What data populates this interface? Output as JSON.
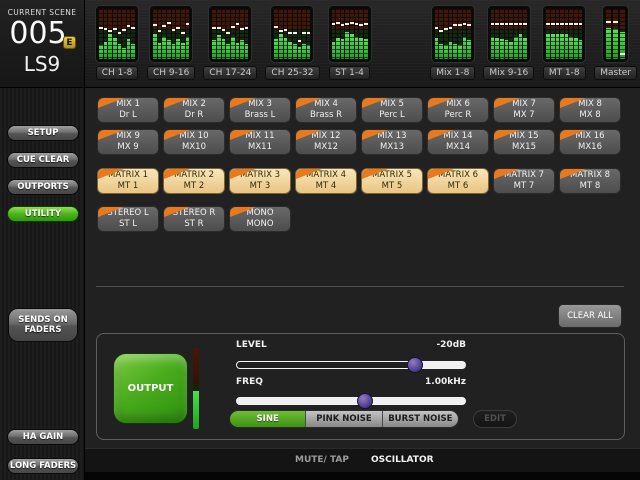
{
  "scene": {
    "label": "CURRENT SCENE",
    "number": "005",
    "edit_badge": "E",
    "name": "LS9"
  },
  "meter_bridge": {
    "blocks": [
      {
        "label": "CH 1-8",
        "group": "left",
        "levels": [
          0.28,
          0.34,
          0.5,
          0.42,
          0.3,
          0.22,
          0.4,
          0.3
        ],
        "markers": [
          0.36,
          0.38,
          0.42,
          0.38,
          0.45,
          0.4,
          0.32,
          0.36
        ]
      },
      {
        "label": "CH 9-16",
        "group": "left",
        "levels": [
          0.5,
          0.32,
          0.45,
          0.38,
          0.3,
          0.4,
          0.32,
          0.45
        ],
        "markers": [
          0.3,
          0.42,
          0.32,
          0.25,
          0.4,
          0.35,
          0.45,
          0.28
        ]
      },
      {
        "label": "CH 17-24",
        "group": "left",
        "levels": [
          0.38,
          0.48,
          0.4,
          0.3,
          0.45,
          0.32,
          0.38,
          0.3
        ],
        "markers": [
          0.35,
          0.35,
          0.4,
          0.45,
          0.33,
          0.28,
          0.38,
          0.35
        ]
      },
      {
        "label": "CH 25-32",
        "group": "left",
        "levels": [
          0.4,
          0.5,
          0.42,
          0.35,
          0.3,
          0.25,
          0.3,
          0.28
        ],
        "markers": [
          0.33,
          0.42,
          0.4,
          0.45,
          0.45,
          0.62,
          0.45,
          0.45
        ]
      },
      {
        "label": "ST 1-4",
        "group": "left",
        "levels": [
          0.35,
          0.42,
          0.4,
          0.55,
          0.5,
          0.45,
          0.42,
          0.4
        ],
        "markers": [
          0.28,
          0.25,
          0.3,
          0.28,
          0.26,
          0.28,
          0.3,
          0.28
        ]
      },
      {
        "label": "Mix 1-8",
        "group": "right",
        "levels": [
          0.42,
          0.3,
          0.28,
          0.35,
          0.3,
          0.28,
          0.45,
          0.38
        ],
        "markers": [
          0.35,
          0.42,
          0.38,
          0.35,
          0.3,
          0.3,
          0.28,
          0.3
        ]
      },
      {
        "label": "Mix 9-16",
        "group": "right",
        "levels": [
          0.45,
          0.42,
          0.4,
          0.38,
          0.35,
          0.45,
          0.5,
          0.42
        ],
        "markers": [
          0.28,
          0.28,
          0.28,
          0.28,
          0.28,
          0.28,
          0.28,
          0.28
        ]
      },
      {
        "label": "MT 1-8",
        "group": "right",
        "levels": [
          0.5,
          0.5,
          0.5,
          0.5,
          0.5,
          0.45,
          0.42,
          0.38
        ],
        "markers": [
          0.28,
          0.28,
          0.28,
          0.28,
          0.28,
          0.28,
          0.28,
          0.28
        ]
      },
      {
        "label": "Master",
        "group": "right",
        "levels": [
          0.62,
          0.6,
          0.55
        ],
        "markers": [
          0.24,
          0.24,
          0.88
        ]
      }
    ]
  },
  "sidebar": {
    "buttons": [
      {
        "label": "SETUP",
        "active": false
      },
      {
        "label": "CUE CLEAR",
        "active": false
      },
      {
        "label": "OUTPORTS",
        "active": false
      },
      {
        "label": "UTILITY",
        "active": true
      }
    ],
    "sends_on_faders_line1": "SENDS ON",
    "sends_on_faders_line2": "FADERS",
    "ha_gain_label": "HA GAIN",
    "long_faders_label": "LONG FADERS"
  },
  "channels": {
    "mix": [
      {
        "title": "MIX 1",
        "sub": "Dr L",
        "on": false
      },
      {
        "title": "MIX 2",
        "sub": "Dr R",
        "on": false
      },
      {
        "title": "MIX 3",
        "sub": "Brass L",
        "on": false
      },
      {
        "title": "MIX 4",
        "sub": "Brass R",
        "on": false
      },
      {
        "title": "MIX 5",
        "sub": "Perc L",
        "on": false
      },
      {
        "title": "MIX 6",
        "sub": "Perc R",
        "on": false
      },
      {
        "title": "MIX 7",
        "sub": "MX 7",
        "on": false
      },
      {
        "title": "MIX 8",
        "sub": "MX 8",
        "on": false
      },
      {
        "title": "MIX 9",
        "sub": "MX 9",
        "on": false
      },
      {
        "title": "MIX 10",
        "sub": "MX10",
        "on": false
      },
      {
        "title": "MIX 11",
        "sub": "MX11",
        "on": false
      },
      {
        "title": "MIX 12",
        "sub": "MX12",
        "on": false
      },
      {
        "title": "MIX 13",
        "sub": "MX13",
        "on": false
      },
      {
        "title": "MIX 14",
        "sub": "MX14",
        "on": false
      },
      {
        "title": "MIX 15",
        "sub": "MX15",
        "on": false
      },
      {
        "title": "MIX 16",
        "sub": "MX16",
        "on": false
      }
    ],
    "matrix": [
      {
        "title": "MATRIX 1",
        "sub": "MT 1",
        "on": true
      },
      {
        "title": "MATRIX 2",
        "sub": "MT 2",
        "on": true
      },
      {
        "title": "MATRIX 3",
        "sub": "MT 3",
        "on": true
      },
      {
        "title": "MATRIX 4",
        "sub": "MT 4",
        "on": true
      },
      {
        "title": "MATRIX 5",
        "sub": "MT 5",
        "on": true
      },
      {
        "title": "MATRIX 6",
        "sub": "MT 6",
        "on": true
      },
      {
        "title": "MATRIX 7",
        "sub": "MT 7",
        "on": false
      },
      {
        "title": "MATRIX 8",
        "sub": "MT 8",
        "on": false
      }
    ],
    "stereo": [
      {
        "title": "STEREO L",
        "sub": "ST L",
        "on": false
      },
      {
        "title": "STEREO R",
        "sub": "ST R",
        "on": false
      },
      {
        "title": "MONO",
        "sub": "MONO",
        "on": false
      }
    ]
  },
  "clear_all_label": "CLEAR ALL",
  "oscillator": {
    "output_label": "OUTPUT",
    "meter_level": 0.47,
    "level": {
      "label": "LEVEL",
      "value": "-20dB",
      "position": 0.78
    },
    "freq": {
      "label": "FREQ",
      "value": "1.00kHz",
      "position": 0.56
    },
    "waveforms": [
      {
        "label": "SINE",
        "active": true
      },
      {
        "label": "PINK NOISE",
        "active": false
      },
      {
        "label": "BURST NOISE",
        "active": false
      }
    ],
    "edit_label": "EDIT"
  },
  "bottom_bar": {
    "tabs": [
      {
        "label": "MUTE/ TAP",
        "active": false
      },
      {
        "label": "OSCILLATOR",
        "active": true
      }
    ]
  },
  "colors": {
    "accent_orange": "#e8791c",
    "active_cream": "#f2d79f",
    "active_green": "#4cb31b",
    "meter_green": "#2db32d",
    "slider_knob": "#584794"
  }
}
